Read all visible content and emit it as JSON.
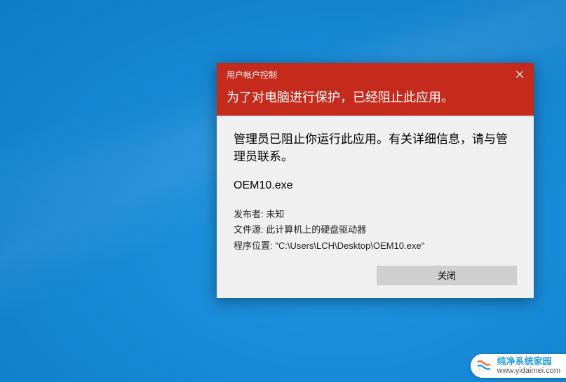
{
  "dialog": {
    "title_small": "用户帐户控制",
    "title_large": "为了对电脑进行保护，已经阻止此应用。",
    "body_text": "管理员已阻止你运行此应用。有关详细信息，请与管理员联系。",
    "filename": "OEM10.exe",
    "publisher_label": "发布者:",
    "publisher_value": "未知",
    "source_label": "文件源:",
    "source_value": "此计算机上的硬盘驱动器",
    "location_label": "程序位置:",
    "location_value": "\"C:\\Users\\LCH\\Desktop\\OEM10.exe\"",
    "close_button": "关闭"
  },
  "watermark": {
    "brand": "纯净系统家园",
    "url": "www.yidaimei.com"
  }
}
